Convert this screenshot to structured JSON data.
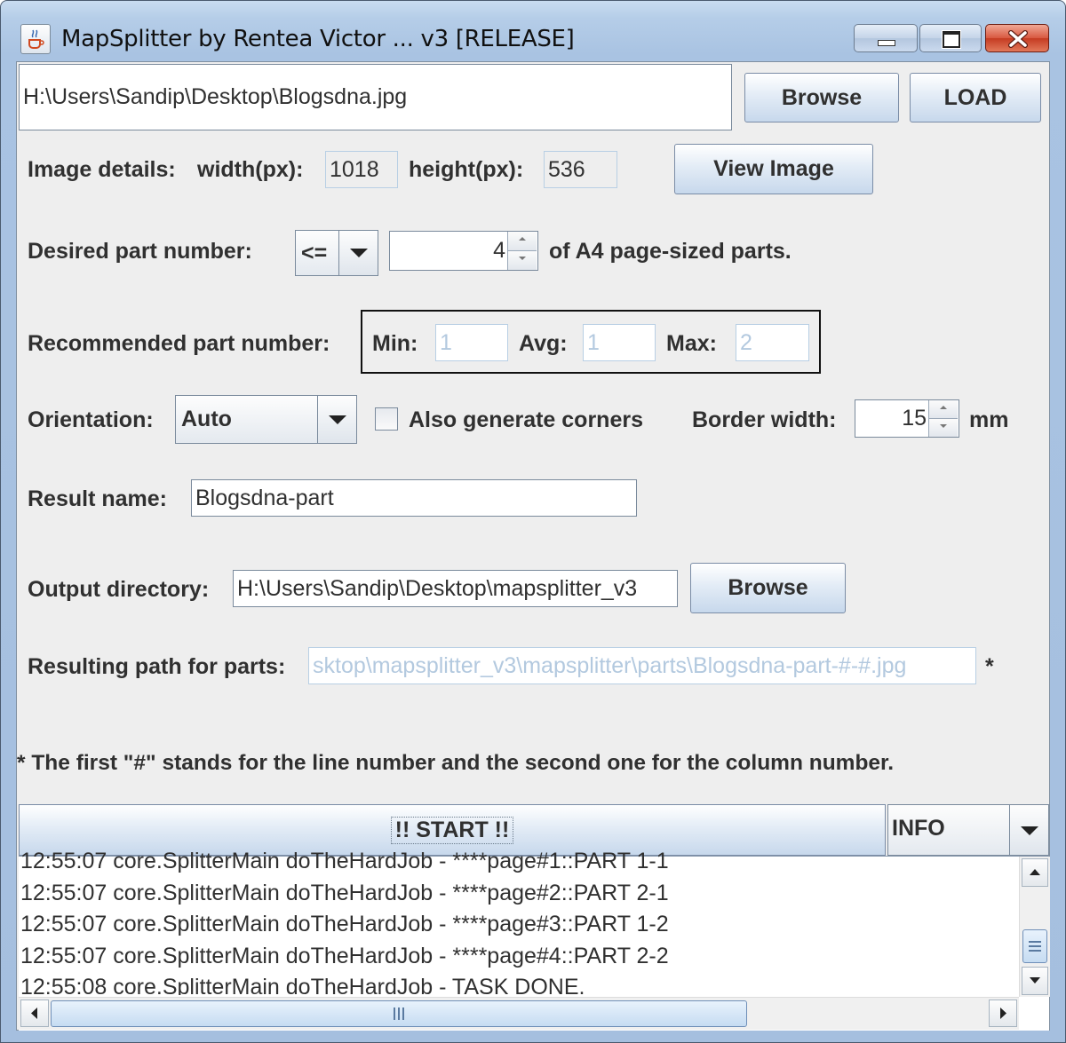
{
  "window": {
    "title": "MapSplitter by Rentea Victor ... v3 [RELEASE]",
    "icons": {
      "app": "java-cup-icon",
      "minimize": "minimize-icon",
      "maximize": "maximize-icon",
      "close": "close-icon"
    }
  },
  "file": {
    "path": "H:\\Users\\Sandip\\Desktop\\Blogsdna.jpg",
    "browse_label": "Browse",
    "load_label": "LOAD"
  },
  "image_details": {
    "label": "Image details:",
    "width_label": "width(px):",
    "width_value": "1018",
    "height_label": "height(px):",
    "height_value": "536",
    "view_label": "View Image"
  },
  "desired": {
    "label": "Desired part number:",
    "operator": "<=",
    "value": "4",
    "suffix": "of A4 page-sized parts."
  },
  "recommended": {
    "label": "Recommended part number:",
    "min_label": "Min:",
    "min_value": "1",
    "avg_label": "Avg:",
    "avg_value": "1",
    "max_label": "Max:",
    "max_value": "2"
  },
  "orientation": {
    "label": "Orientation:",
    "value": "Auto",
    "corners_label": "Also generate corners",
    "corners_checked": false,
    "border_label": "Border width:",
    "border_value": "15",
    "border_unit": "mm"
  },
  "result": {
    "label": "Result name:",
    "value": "Blogsdna-part"
  },
  "output": {
    "label": "Output directory:",
    "value": "H:\\Users\\Sandip\\Desktop\\mapsplitter_v3",
    "browse_label": "Browse"
  },
  "resulting": {
    "label": "Resulting path for parts:",
    "value": "sktop\\mapsplitter_v3\\mapsplitter\\parts\\Blogsdna-part-#-#.jpg",
    "asterisk": "*"
  },
  "footnote": "* The first \"#\" stands for the line number and the second one for the column number.",
  "start_label": "!! START !!",
  "log_level": "INFO",
  "log": [
    "12:55:07 core.SplitterMain doTheHardJob - ****page#1::PART 1-1",
    "12:55:07 core.SplitterMain doTheHardJob - ****page#2::PART 2-1",
    "12:55:07 core.SplitterMain doTheHardJob - ****page#3::PART 1-2",
    "12:55:07 core.SplitterMain doTheHardJob - ****page#4::PART 2-2",
    "12:55:08 core.SplitterMain doTheHardJob - TASK DONE."
  ]
}
